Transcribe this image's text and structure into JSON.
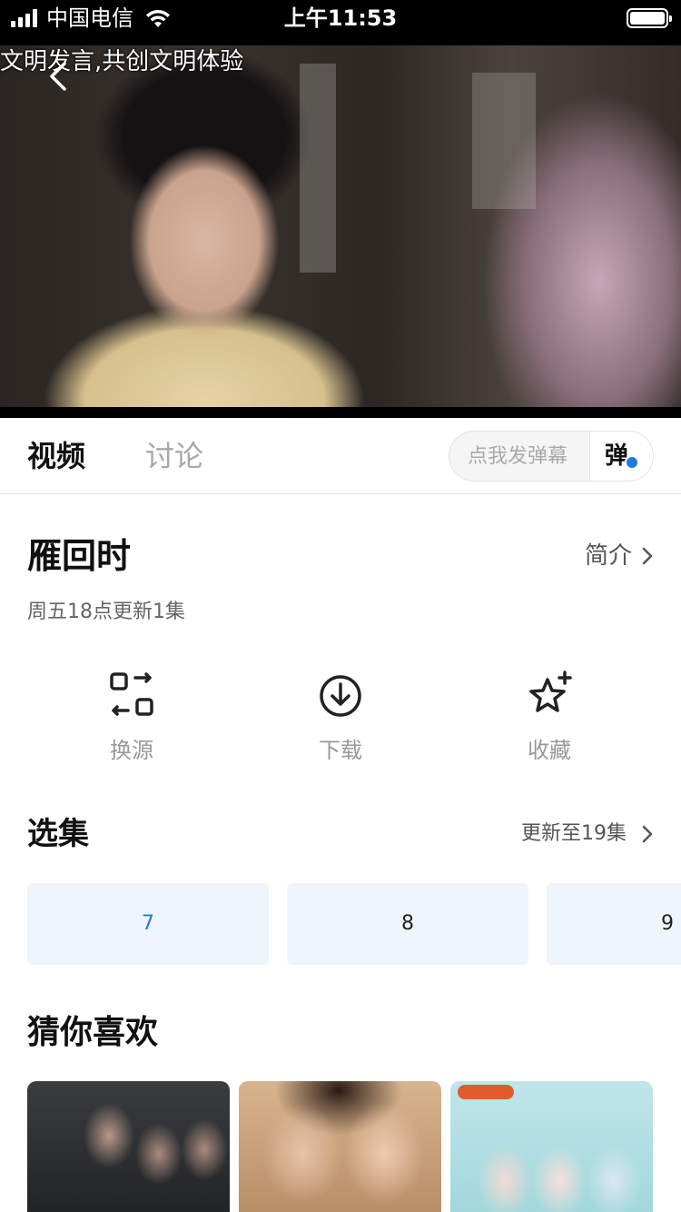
{
  "status_bar": {
    "carrier": "中国电信",
    "time": "上午11:53",
    "icons": [
      "signal-icon",
      "wifi-icon",
      "battery-icon"
    ]
  },
  "video": {
    "danmaku": "文明发言,共创文明体验",
    "back_icon": "chevron-left-icon"
  },
  "tabs": {
    "items": [
      {
        "label": "视频",
        "active": true
      },
      {
        "label": "讨论",
        "active": false
      }
    ],
    "danmaku_placeholder": "点我发弹幕",
    "danmaku_button": "弹"
  },
  "show": {
    "title": "雁回时",
    "intro_link": "简介",
    "update_info": "周五18点更新1集"
  },
  "actions": [
    {
      "label": "换源",
      "icon": "switch-source-icon"
    },
    {
      "label": "下载",
      "icon": "download-icon"
    },
    {
      "label": "收藏",
      "icon": "star-icon"
    }
  ],
  "episodes": {
    "title": "选集",
    "more": "更新至19集",
    "items": [
      "7",
      "8",
      "9"
    ],
    "current": "7"
  },
  "recommendations": {
    "title": "猜你喜欢"
  },
  "colors": {
    "accent": "#1f7ae0",
    "episode_bg": "#f0f4fb",
    "muted_text": "#999999"
  }
}
